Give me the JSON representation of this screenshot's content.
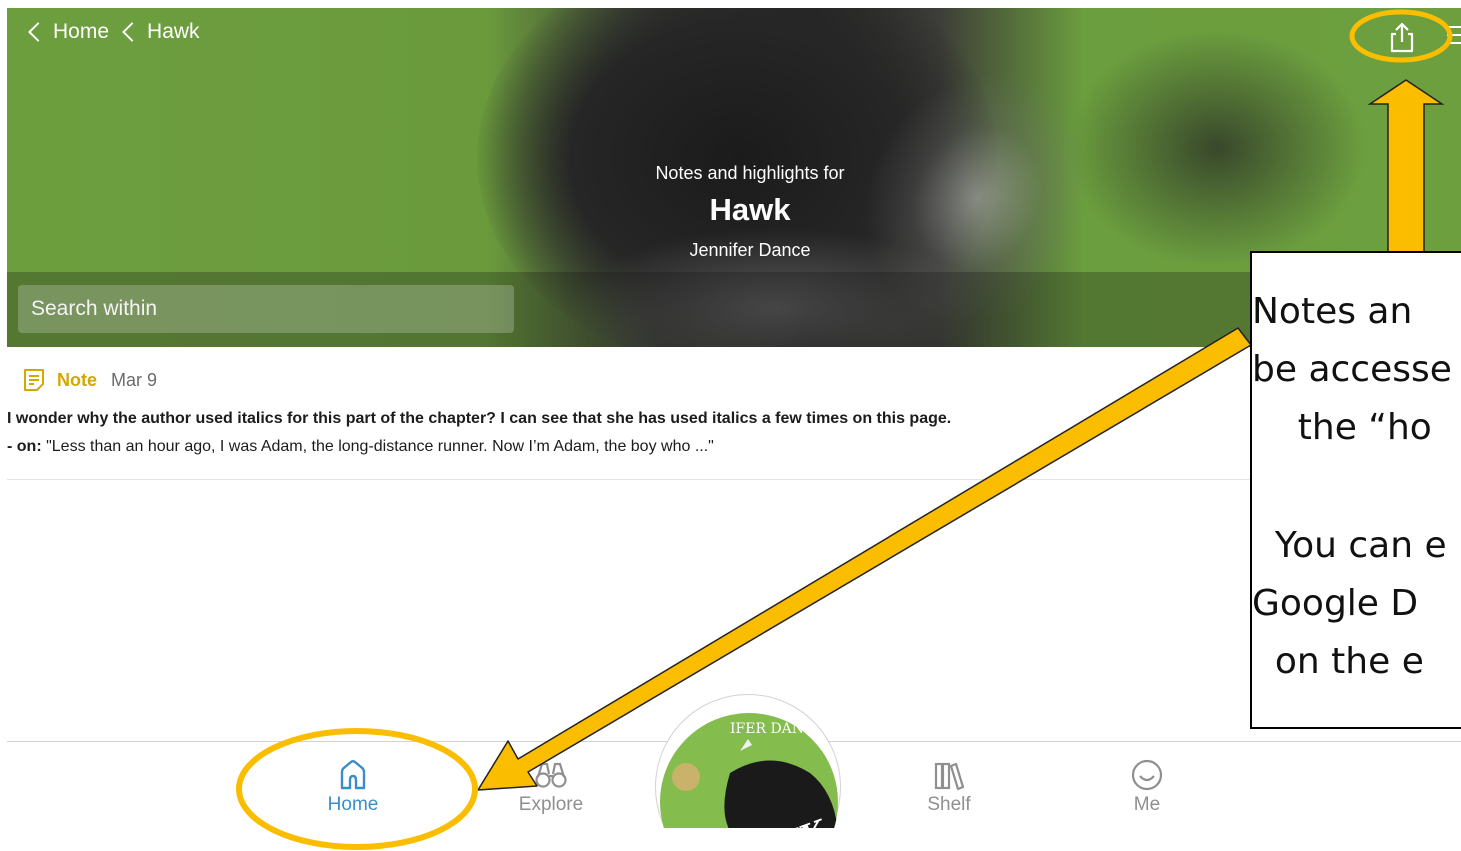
{
  "breadcrumbs": [
    {
      "label": "Home"
    },
    {
      "label": "Hawk"
    }
  ],
  "header": {
    "subtitle": "Notes and highlights for",
    "title": "Hawk",
    "author": "Jennifer Dance",
    "search_placeholder": "Search within"
  },
  "note": {
    "type_label": "Note",
    "date": "Mar 9",
    "text": "I wonder why the author used italics for this part of the chapter? I can see that she has used italics a few times on this page.",
    "on_label": "- on:",
    "quote": " \"Less than an hour ago, I was Adam, the long-distance runner. Now I’m Adam, the boy who ...\""
  },
  "nav": {
    "home": "Home",
    "explore": "Explore",
    "shelf": "Shelf",
    "me": "Me",
    "book_cover_author": "IFER DANC",
    "book_cover_title": "HAWK"
  },
  "annotation": {
    "lines_1": [
      "Notes an",
      "be accesse",
      "    the “ho"
    ],
    "lines_2": [
      "  You can e",
      "Google D",
      "  on the e"
    ]
  },
  "colors": {
    "accent_blue": "#3b8dc8",
    "note_yellow": "#d4a800",
    "header_green": "#6d9e3e",
    "annotation_gold": "#fbbd00"
  },
  "icons": [
    "share-icon",
    "menu-icon",
    "note-icon",
    "home-icon",
    "explore-binoculars-icon",
    "shelf-icon",
    "me-smiley-icon"
  ]
}
